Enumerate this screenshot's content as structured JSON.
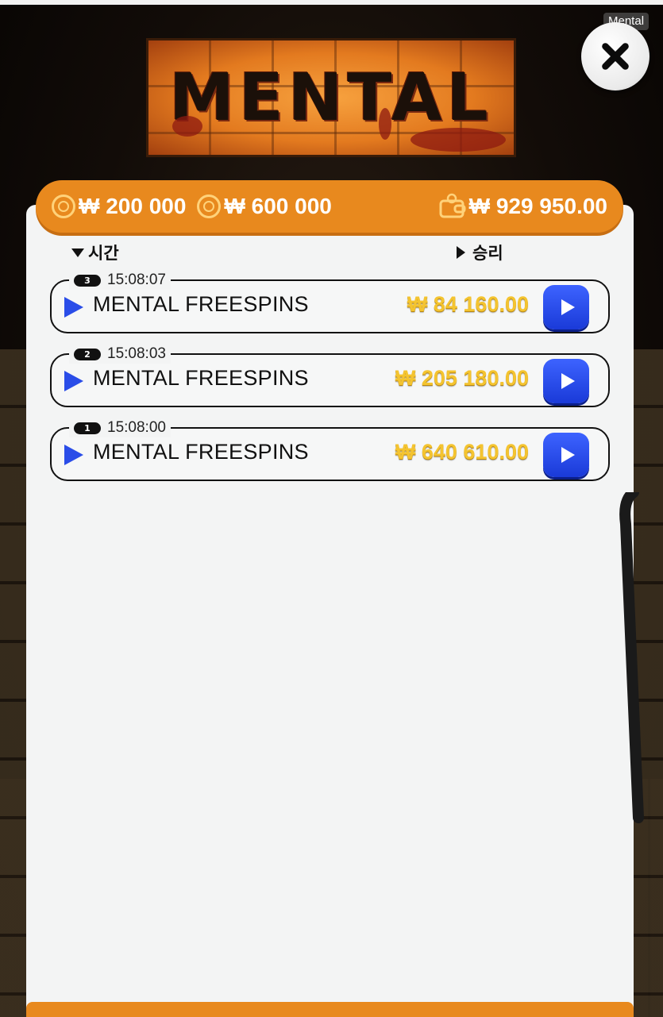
{
  "window": {
    "tooltip": "Mental"
  },
  "header": {
    "logo_text": "MENTAL"
  },
  "balances": {
    "currency": "₩",
    "bet_1": "₩ 200 000",
    "bet_2": "₩ 600 000",
    "wallet": "₩ 929 950.00"
  },
  "columns": {
    "time": "시간",
    "win": "승리"
  },
  "history": [
    {
      "index": "3",
      "time": "15:08:07",
      "title": "MENTAL FREESPINS",
      "amount": "₩ 84 160.00"
    },
    {
      "index": "2",
      "time": "15:08:03",
      "title": "MENTAL FREESPINS",
      "amount": "₩ 205 180.00"
    },
    {
      "index": "1",
      "time": "15:08:00",
      "title": "MENTAL FREESPINS",
      "amount": "₩ 640 610.00"
    }
  ],
  "colors": {
    "accent_orange": "#e8891e",
    "play_blue": "#2a4de8",
    "amount_gold": "#f4c430"
  },
  "icons": {
    "close": "close-icon",
    "coin": "coin-icon",
    "wallet": "wallet-icon",
    "play": "play-icon"
  }
}
